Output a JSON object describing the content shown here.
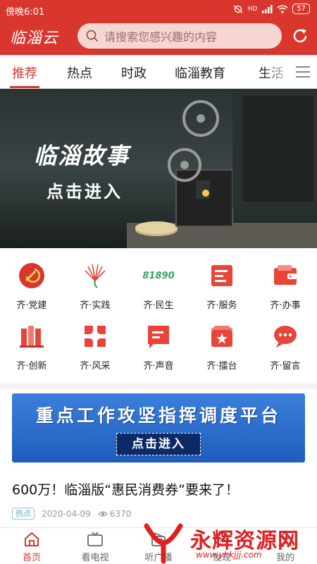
{
  "status_bar": {
    "time": "傍晚6:01",
    "battery": "57",
    "network": "HD"
  },
  "header": {
    "logo": "临淄云",
    "search_placeholder": "请搜索您感兴趣的内容"
  },
  "tabs": [
    {
      "label": "推荐",
      "active": true
    },
    {
      "label": "热点"
    },
    {
      "label": "时政"
    },
    {
      "label": "临淄教育"
    },
    {
      "label": "生活"
    }
  ],
  "banner": {
    "title": "临淄故事",
    "cta": "点击进入"
  },
  "grid": [
    {
      "label": "齐·党建",
      "icon": "party-emblem-icon"
    },
    {
      "label": "齐·实践",
      "icon": "practice-fan-icon"
    },
    {
      "label": "齐·民生",
      "icon": "hotline-81890-icon",
      "icon_text": "81890"
    },
    {
      "label": "齐·服务",
      "icon": "service-document-icon"
    },
    {
      "label": "齐·办事",
      "icon": "wallet-icon"
    },
    {
      "label": "齐·创新",
      "icon": "books-icon"
    },
    {
      "label": "齐·风采",
      "icon": "petal-grid-icon"
    },
    {
      "label": "齐·声音",
      "icon": "message-square-icon"
    },
    {
      "label": "齐·擂台",
      "icon": "star-box-icon"
    },
    {
      "label": "齐·留言",
      "icon": "chat-bubble-icon"
    }
  ],
  "promo": {
    "title": "重点工作攻坚指挥调度平台",
    "cta": "点击进入"
  },
  "news": {
    "title": "600万！临淄版“惠民消费券”要来了！",
    "tag": "热点",
    "date": "2020-04-09",
    "views": "6370"
  },
  "bottom_nav": [
    {
      "label": "首页",
      "icon": "home-icon",
      "active": true
    },
    {
      "label": "看电视",
      "icon": "tv-icon"
    },
    {
      "label": "听广播",
      "icon": "radio-icon"
    },
    {
      "label": "发现",
      "icon": "discover-icon"
    },
    {
      "label": "我的",
      "icon": "profile-icon"
    }
  ],
  "watermark": {
    "text": "永辉资源网",
    "url": "www.yhkjjj.com"
  },
  "colors": {
    "brand_red": "#d9372e",
    "promo_blue": "#1f5dbd",
    "tag_teal": "#5ab0c8"
  }
}
